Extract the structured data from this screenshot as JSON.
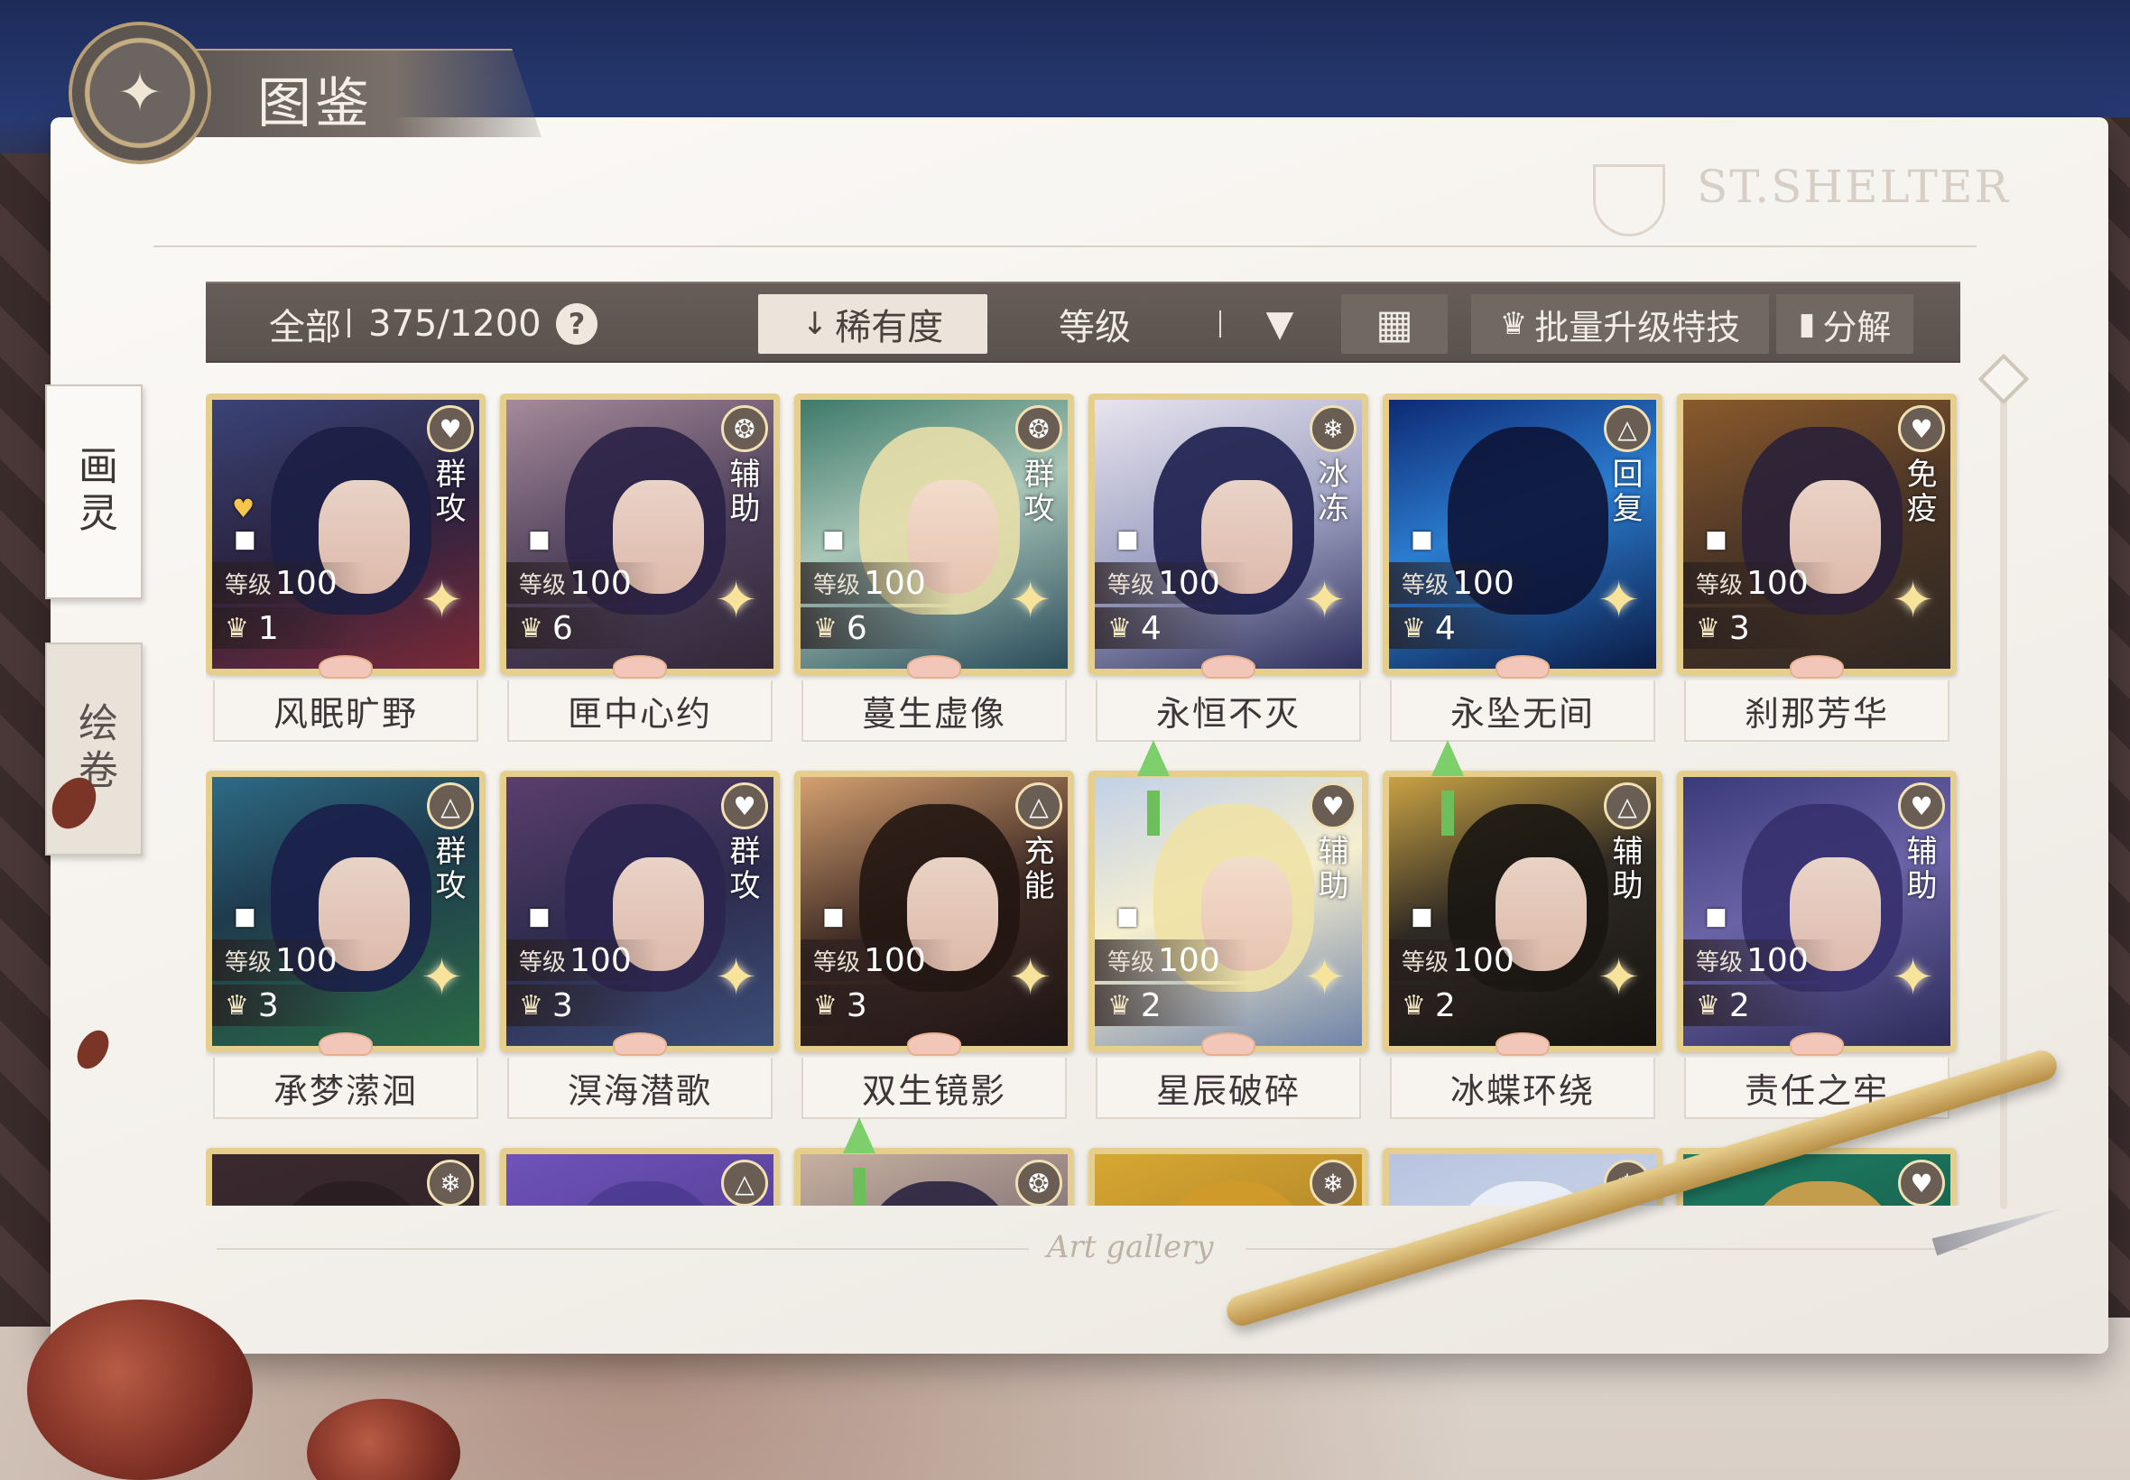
{
  "header": {
    "title": "图鉴",
    "brand": "ST.SHELTER"
  },
  "side_tabs": [
    {
      "label": "画灵",
      "active": true
    },
    {
      "label": "绘卷",
      "active": false
    }
  ],
  "toolbar": {
    "filter_all": "全部",
    "collection_count": "375/1200",
    "help": "?",
    "sort_rarity": "稀有度",
    "sort_level": "等级",
    "batch_upgrade": "批量升级特技",
    "decompose": "分解"
  },
  "level_tag": "等级",
  "cards": [
    {
      "name": "风眠旷野",
      "role": "群攻",
      "level": "100",
      "stars": "1",
      "role_icon": "heart-pulse-icon",
      "favorite": true,
      "upgrade": false
    },
    {
      "name": "匣中心约",
      "role": "辅助",
      "level": "100",
      "stars": "6",
      "role_icon": "shield-swirl-icon",
      "favorite": false,
      "upgrade": false
    },
    {
      "name": "蔓生虚像",
      "role": "群攻",
      "level": "100",
      "stars": "6",
      "role_icon": "shield-swirl-icon",
      "favorite": false,
      "upgrade": false
    },
    {
      "name": "永恒不灭",
      "role": "冰冻",
      "level": "100",
      "stars": "4",
      "role_icon": "snowflake-icon",
      "favorite": false,
      "upgrade": false
    },
    {
      "name": "永坠无间",
      "role": "回复",
      "level": "100",
      "stars": "4",
      "role_icon": "triangle-circle-icon",
      "favorite": false,
      "upgrade": false
    },
    {
      "name": "刹那芳华",
      "role": "免疫",
      "level": "100",
      "stars": "3",
      "role_icon": "heart-pulse-icon",
      "favorite": false,
      "upgrade": false
    },
    {
      "name": "承梦潆洄",
      "role": "群攻",
      "level": "100",
      "stars": "3",
      "role_icon": "triangle-circle-icon",
      "favorite": false,
      "upgrade": false
    },
    {
      "name": "溟海潜歌",
      "role": "群攻",
      "level": "100",
      "stars": "3",
      "role_icon": "heart-pulse-icon",
      "favorite": false,
      "upgrade": false
    },
    {
      "name": "双生镜影",
      "role": "充能",
      "level": "100",
      "stars": "3",
      "role_icon": "triangle-circle-icon",
      "favorite": false,
      "upgrade": false
    },
    {
      "name": "星辰破碎",
      "role": "辅助",
      "level": "100",
      "stars": "2",
      "role_icon": "heart-pulse-icon",
      "favorite": false,
      "upgrade": true
    },
    {
      "name": "冰蝶环绕",
      "role": "辅助",
      "level": "100",
      "stars": "2",
      "role_icon": "triangle-circle-icon",
      "favorite": false,
      "upgrade": true
    },
    {
      "name": "责任之牢",
      "role": "辅助",
      "level": "100",
      "stars": "2",
      "role_icon": "heart-pulse-icon",
      "favorite": false,
      "upgrade": false
    },
    {
      "name": "",
      "role": "",
      "level": "",
      "stars": "",
      "role_icon": "snowflake-icon",
      "favorite": false,
      "upgrade": false
    },
    {
      "name": "",
      "role": "",
      "level": "",
      "stars": "",
      "role_icon": "triangle-circle-icon",
      "favorite": false,
      "upgrade": false
    },
    {
      "name": "",
      "role": "",
      "level": "",
      "stars": "",
      "role_icon": "shield-swirl-icon",
      "favorite": false,
      "upgrade": true
    },
    {
      "name": "",
      "role": "",
      "level": "",
      "stars": "",
      "role_icon": "snowflake-icon",
      "favorite": false,
      "upgrade": false
    },
    {
      "name": "",
      "role": "",
      "level": "",
      "stars": "",
      "role_icon": "snowflake-icon",
      "favorite": false,
      "upgrade": false
    },
    {
      "name": "",
      "role": "",
      "level": "",
      "stars": "",
      "role_icon": "heart-pulse-icon",
      "favorite": false,
      "upgrade": false
    }
  ],
  "footer": "Art gallery",
  "colors": {
    "toolbar_bg": "#5f5651",
    "card_border": "#e6cf8c",
    "page_bg": "#f7f4f0"
  }
}
